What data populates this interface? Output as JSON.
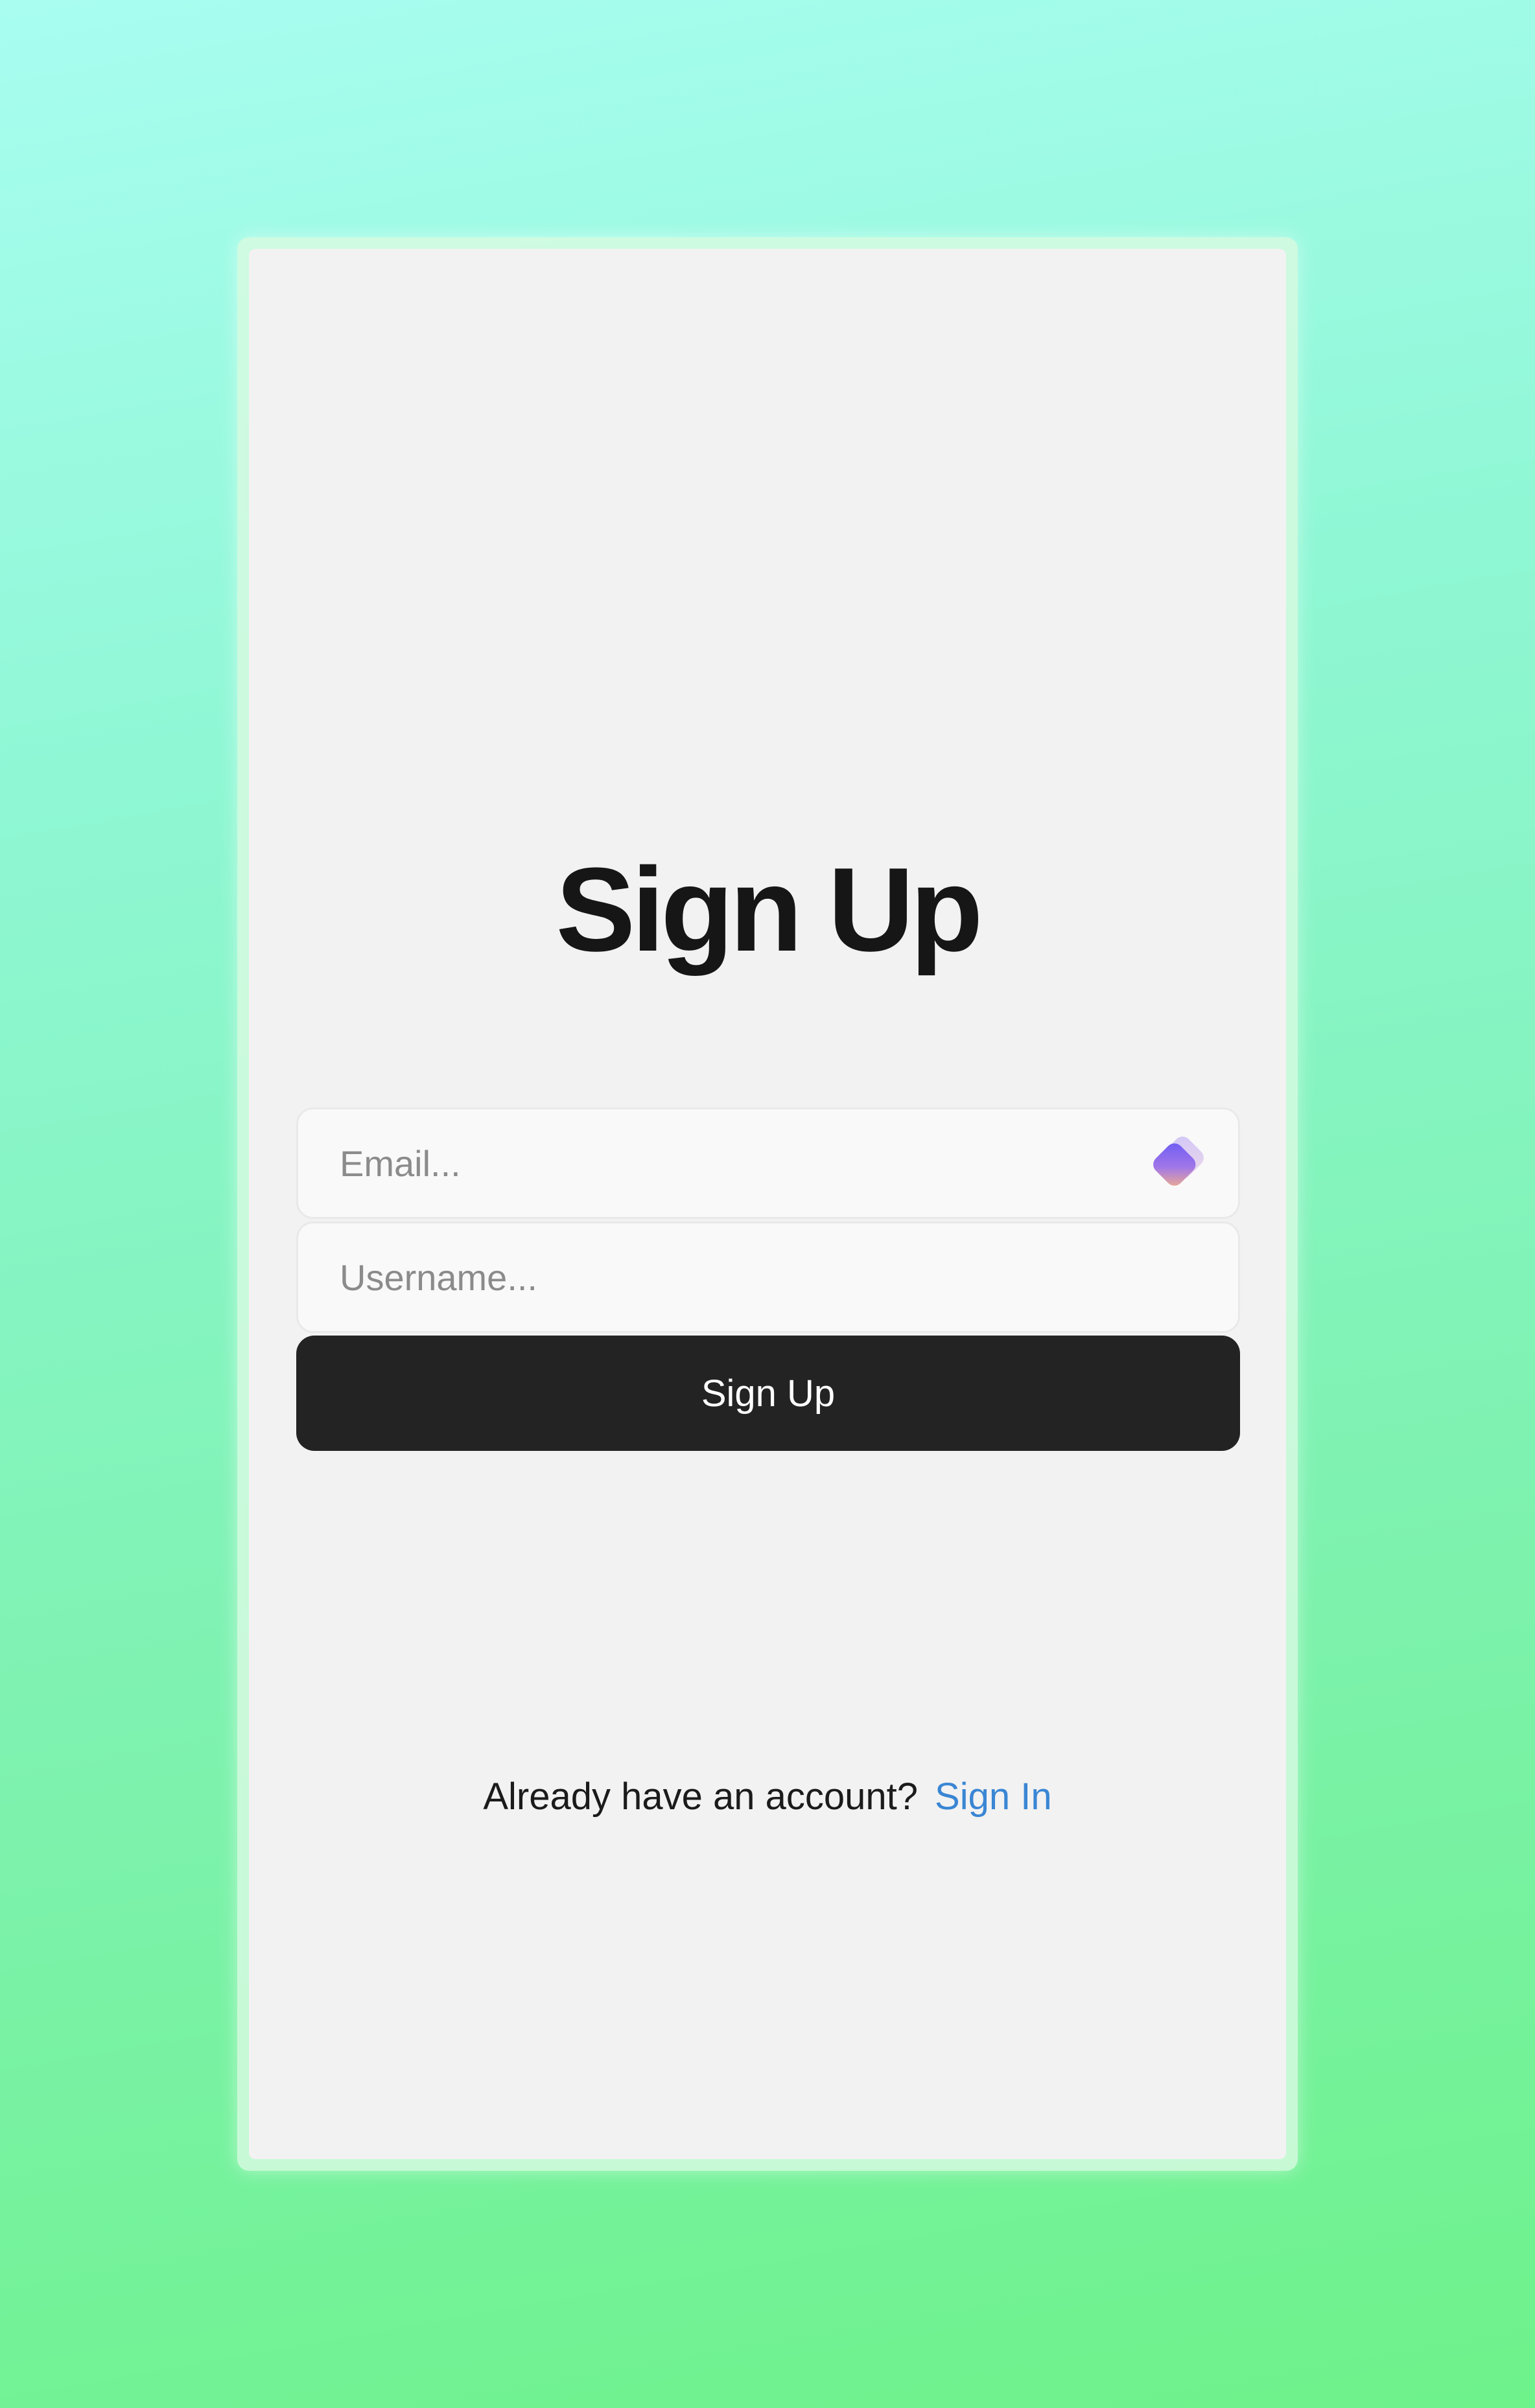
{
  "page": {
    "background_colors": [
      "#a8fdf0",
      "#6ef28a"
    ]
  },
  "signup_card": {
    "title": "Sign Up",
    "email_input": {
      "value": "",
      "placeholder": "Email..."
    },
    "username_input": {
      "value": "",
      "placeholder": "Username..."
    },
    "submit_label": "Sign Up",
    "footer": {
      "prompt": "Already have an account?",
      "signin_link": "Sign In",
      "link_color": "#3a86d4"
    },
    "icons": {
      "email_field_icon": "password-manager-icon"
    }
  },
  "colors": {
    "button_background": "#232323",
    "card_background": "#f2f2f2",
    "title_color": "#161616"
  }
}
